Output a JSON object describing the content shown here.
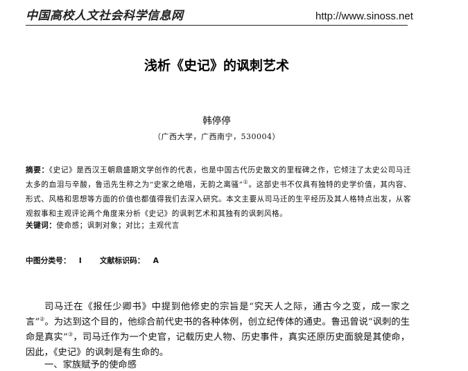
{
  "header": {
    "logo_text": "中国高校人文社会科学信息网",
    "url": "http://www.sinoss.net"
  },
  "paper": {
    "title": "浅析《史记》的讽刺艺术",
    "author": "韩停停",
    "affiliation": "（广西大学，广西南宁，530004）",
    "abstract_label": "摘要：",
    "abstract_part1": "《史记》是西汉王朝鼎盛期文学创作的代表，也是中国古代历史散文的里程碑之作，它倾注了太史公司马迁太多的血泪与辛酸，鲁迅先生称之为“史家之绝唱，无韵之离骚”",
    "abstract_note1": "①",
    "abstract_part2": "。这部史书不仅具有独特的史学价值，其内容、形式、风格和思想等方面的价值也都值得我们去深入研究。本文主要从司马迁的生平经历及其人格特点出发，从客观叙事和主观评论两个角度来分析《史记》的讽刺艺术和其独有的讽刺风格。",
    "keywords_label": "关键词：",
    "keywords": "使命感；讽刺对象；对比；主观代言",
    "class_label": "中图分类号：",
    "class_value": "I",
    "doc_label": "文献标识码：",
    "doc_value": "A",
    "body_part1": "司马迁在《报任少卿书》中提到他修史的宗旨是“究天人之际，通古今之变，成一家之言”",
    "body_note2": "②",
    "body_part2": "。为达到这个目的，他综合前代史书的各种体例，创立纪传体的通史。鲁迅曾说“讽刺的生命是真实”",
    "body_note3": "③",
    "body_part3": "，司马迁作为一个史官，记载历史人物、历史事件，真实还原历史面貌是其使命，因此，《史记》的讽刺是有生命的。",
    "section_heading": "一、家族赋予的使命感"
  }
}
